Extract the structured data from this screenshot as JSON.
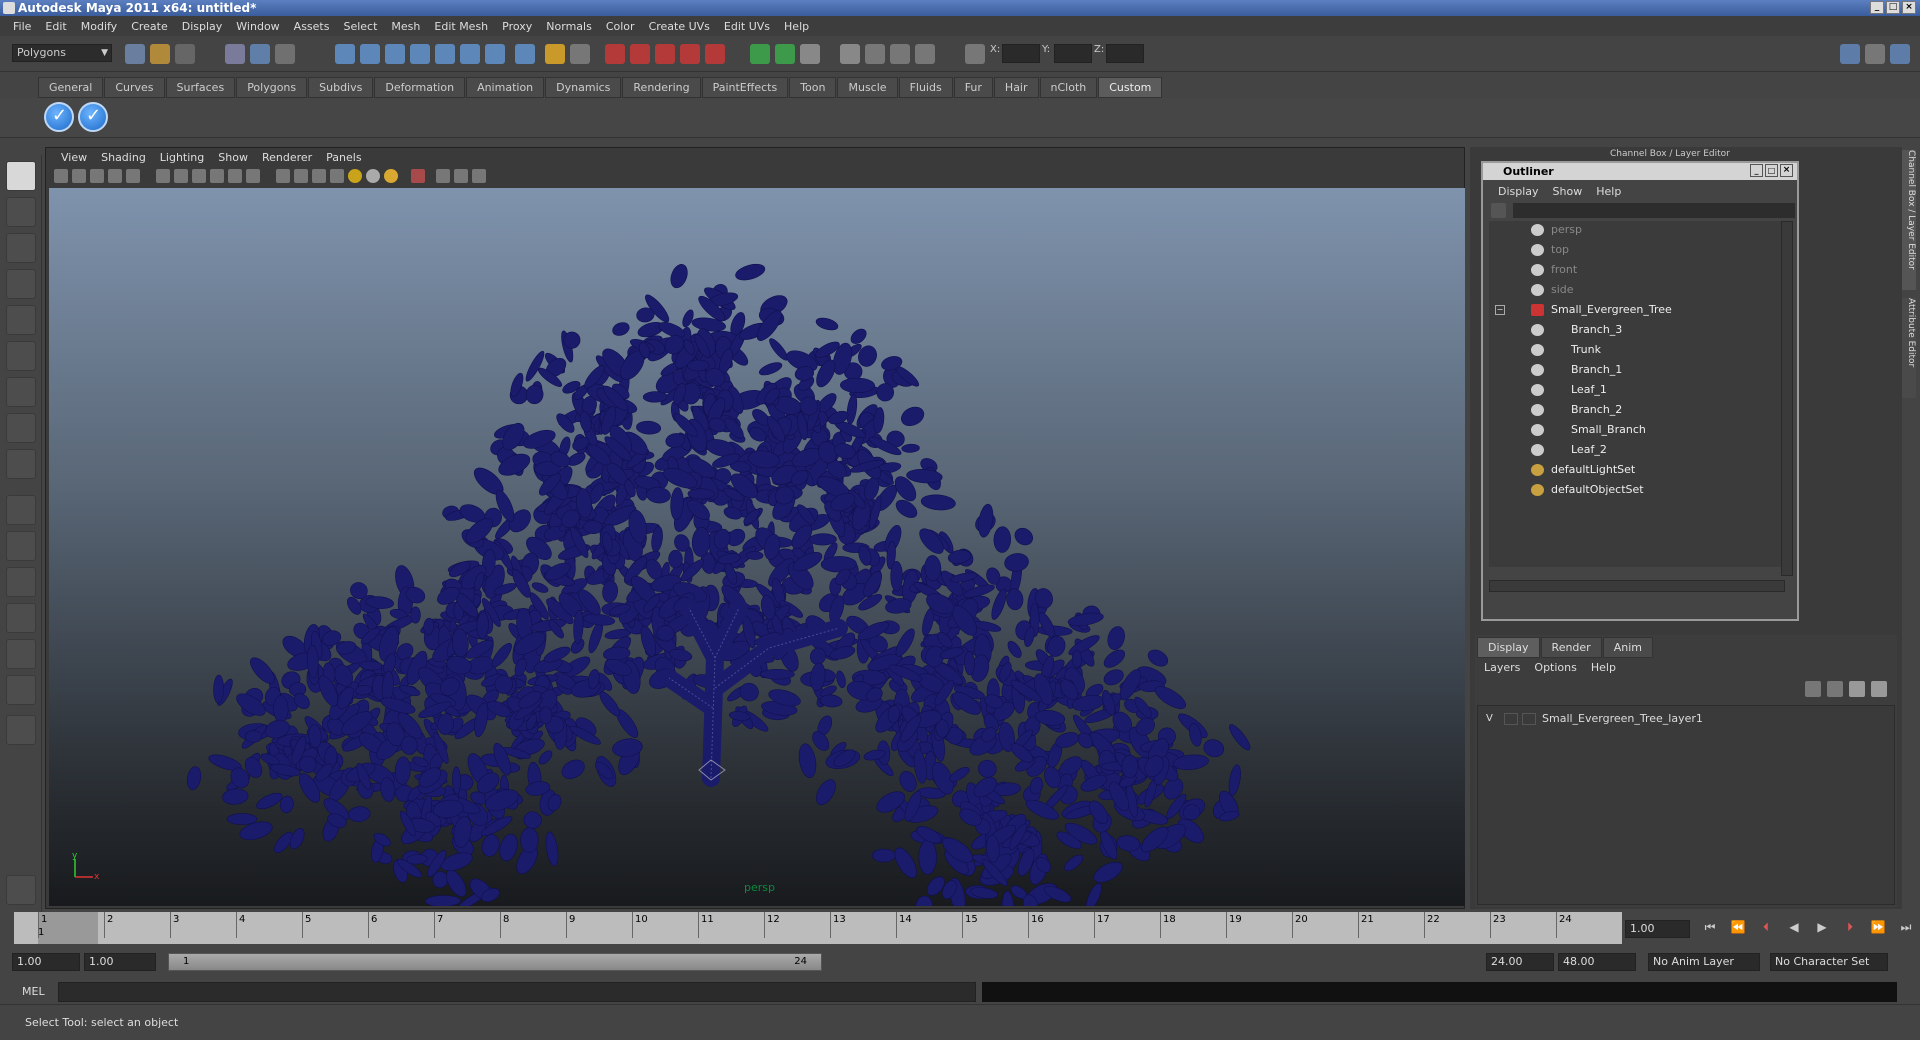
{
  "window": {
    "title": "Autodesk Maya 2011 x64: untitled*"
  },
  "menubar": [
    "File",
    "Edit",
    "Modify",
    "Create",
    "Display",
    "Window",
    "Assets",
    "Select",
    "Mesh",
    "Edit Mesh",
    "Proxy",
    "Normals",
    "Color",
    "Create UVs",
    "Edit UVs",
    "Help"
  ],
  "statusline": {
    "menuset": "Polygons",
    "x_label": "X:",
    "y_label": "Y:",
    "z_label": "Z:"
  },
  "shelf_tabs": [
    "General",
    "Curves",
    "Surfaces",
    "Polygons",
    "Subdivs",
    "Deformation",
    "Animation",
    "Dynamics",
    "Rendering",
    "PaintEffects",
    "Toon",
    "Muscle",
    "Fluids",
    "Fur",
    "Hair",
    "nCloth",
    "Custom"
  ],
  "shelf_active_tab": "Custom",
  "viewport": {
    "menu": [
      "View",
      "Shading",
      "Lighting",
      "Show",
      "Renderer",
      "Panels"
    ],
    "camera_label": "persp",
    "axis_y": "y",
    "axis_x": "x",
    "mesh_color": "#1b1b6b"
  },
  "right_panel": {
    "header": "Channel Box / Layer Editor",
    "side_tabs": [
      "Channel Box / Layer Editor",
      "Attribute Editor"
    ]
  },
  "outliner": {
    "title": "Outliner",
    "menu": [
      "Display",
      "Show",
      "Help"
    ],
    "items": [
      {
        "label": "persp",
        "type": "camera"
      },
      {
        "label": "top",
        "type": "camera"
      },
      {
        "label": "front",
        "type": "camera"
      },
      {
        "label": "side",
        "type": "camera"
      },
      {
        "label": "Small_Evergreen_Tree",
        "type": "group"
      },
      {
        "label": "Branch_3",
        "type": "mesh"
      },
      {
        "label": "Trunk",
        "type": "mesh"
      },
      {
        "label": "Branch_1",
        "type": "mesh"
      },
      {
        "label": "Leaf_1",
        "type": "mesh"
      },
      {
        "label": "Branch_2",
        "type": "mesh"
      },
      {
        "label": "Small_Branch",
        "type": "mesh"
      },
      {
        "label": "Leaf_2",
        "type": "mesh"
      },
      {
        "label": "defaultLightSet",
        "type": "set"
      },
      {
        "label": "defaultObjectSet",
        "type": "set"
      }
    ]
  },
  "layer_editor": {
    "tabs": [
      "Display",
      "Render",
      "Anim"
    ],
    "menu": [
      "Layers",
      "Options",
      "Help"
    ],
    "layers": [
      {
        "visible": "V",
        "name": "Small_Evergreen_Tree_layer1"
      }
    ]
  },
  "timeline": {
    "ticks": [
      "1",
      "2",
      "3",
      "4",
      "5",
      "6",
      "7",
      "8",
      "9",
      "10",
      "11",
      "12",
      "13",
      "14",
      "15",
      "16",
      "17",
      "18",
      "19",
      "20",
      "21",
      "22",
      "23",
      "24"
    ],
    "current_frame": "1.00",
    "current_marker": "1"
  },
  "range": {
    "start": "1.00",
    "playback_start": "1.00",
    "slider_min": "1",
    "slider_max": "24",
    "playback_end": "24.00",
    "end": "48.00",
    "anim_layer": "No Anim Layer",
    "character_set": "No Character Set"
  },
  "command_line": {
    "label": "MEL"
  },
  "help_line": {
    "text": "Select Tool: select an object"
  }
}
